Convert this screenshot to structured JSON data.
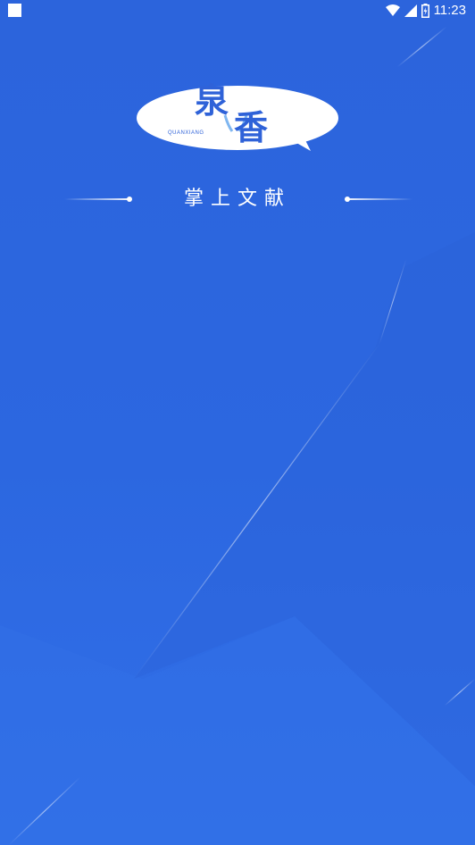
{
  "status_bar": {
    "time": "11:23",
    "icons": [
      "notification-square-icon",
      "wifi-icon",
      "signal-icon",
      "battery-icon"
    ]
  },
  "logo": {
    "char_top": "泉",
    "char_bottom": "香",
    "subtitle": "QUANXIANG"
  },
  "tagline": {
    "text": "掌上文献"
  },
  "colors": {
    "background": "#2c66dc",
    "logo_text": "#2f62d8",
    "foreground": "#ffffff"
  }
}
